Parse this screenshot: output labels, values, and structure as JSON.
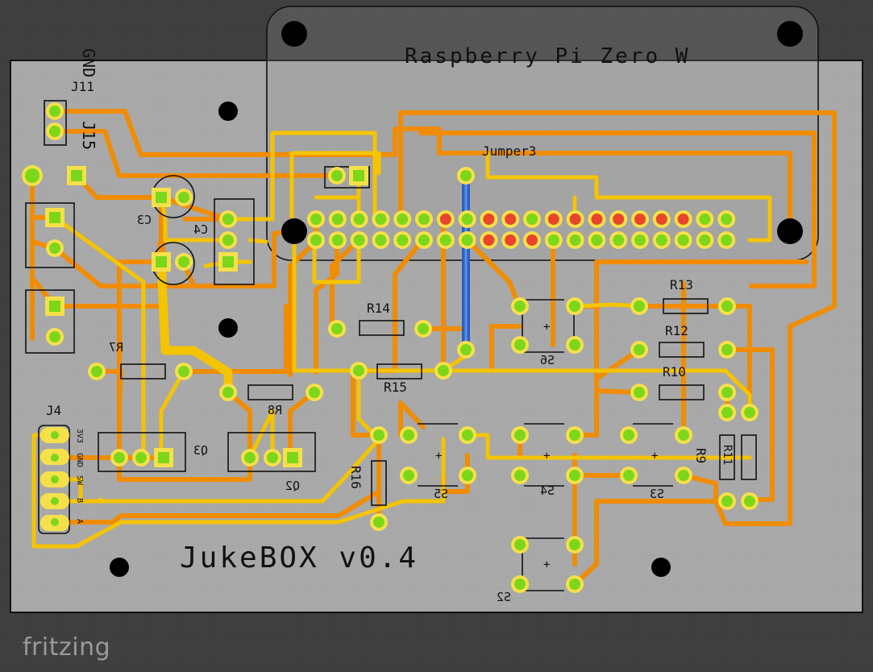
{
  "app": {
    "brand": "fritzing"
  },
  "colors": {
    "background": "#3f3f3f",
    "board": "#a9a9a9",
    "trace_top": "#f5c400",
    "trace_bottom": "#f08c00",
    "pad": "#7cd61a",
    "pad_ring": "#f5e04a",
    "pad_red": "#e8452a",
    "jumper": "#3b74d6",
    "silk": "#111111"
  },
  "board": {
    "title": "JukeBOX v0.4",
    "module_label": "Raspberry Pi Zero W"
  },
  "labels": {
    "j11": "J11",
    "j15": "J15",
    "gnd": "GND",
    "jumper3": "Jumper3",
    "j4": "J4",
    "c3": "C3",
    "c4": "C4",
    "r7": "R7",
    "r8": "R8",
    "q3": "Q3",
    "q2": "Q2",
    "r14": "R14",
    "r15": "R15",
    "r16": "R16",
    "r13": "R13",
    "r12": "R12",
    "r10": "R10",
    "r9": "R9",
    "r11": "R11",
    "s2": "S2",
    "s3": "S3",
    "s4": "S4",
    "s5": "S5",
    "s6": "S6",
    "j4_pins": [
      "3V3",
      "GND",
      "SW",
      "B",
      "A"
    ]
  }
}
